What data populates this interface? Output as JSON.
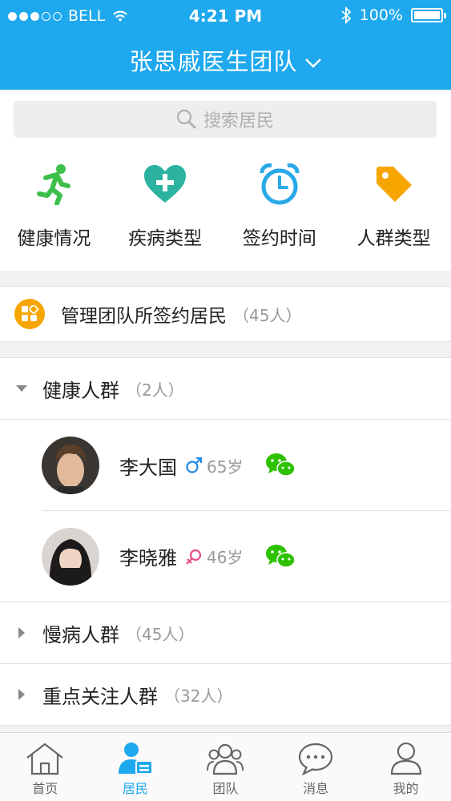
{
  "status_bar": {
    "carrier": "BELL",
    "time": "4:21 PM",
    "battery": "100%"
  },
  "header": {
    "title": "张思戚医生团队"
  },
  "search": {
    "placeholder": "搜索居民"
  },
  "categories": [
    {
      "label": "健康情况",
      "icon": "running-person-icon",
      "color": "#3cc04a"
    },
    {
      "label": "疾病类型",
      "icon": "heart-plus-icon",
      "color": "#2bb3a0"
    },
    {
      "label": "签约时间",
      "icon": "alarm-clock-icon",
      "color": "#29a9e8"
    },
    {
      "label": "人群类型",
      "icon": "tag-icon",
      "color": "#f7a600"
    }
  ],
  "managed": {
    "label": "管理团队所签约居民",
    "count": "（45人）"
  },
  "groups": [
    {
      "name": "健康人群",
      "count": "（2人）",
      "expanded": true,
      "members": [
        {
          "name": "李大国",
          "sex": "male",
          "age": "65岁"
        },
        {
          "name": "李晓雅",
          "sex": "female",
          "age": "46岁"
        }
      ]
    },
    {
      "name": "慢病人群",
      "count": "（45人）",
      "expanded": false
    },
    {
      "name": "重点关注人群",
      "count": "（32人）",
      "expanded": false
    }
  ],
  "tabs": [
    {
      "label": "首页",
      "icon": "home-icon"
    },
    {
      "label": "居民",
      "icon": "resident-icon",
      "active": true
    },
    {
      "label": "团队",
      "icon": "team-icon"
    },
    {
      "label": "消息",
      "icon": "message-icon"
    },
    {
      "label": "我的",
      "icon": "profile-icon"
    }
  ],
  "colors": {
    "primary": "#1ea8ee",
    "male": "#1e88e5",
    "female": "#e84c8a",
    "wechat": "#2dc100"
  }
}
